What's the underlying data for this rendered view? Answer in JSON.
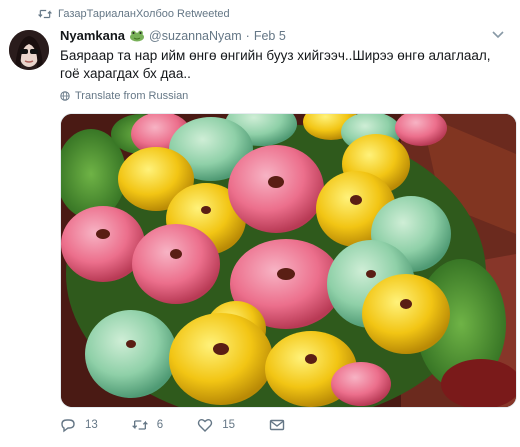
{
  "retweet": {
    "icon": "retweet-icon",
    "text": "ГазарТариаланХолбоо Retweeted"
  },
  "tweet": {
    "display_name": "Nyamkana",
    "name_emoji": "frog-icon",
    "handle": "@suzannaNyam",
    "separator": "·",
    "time": "Feb 5",
    "text": "Баяраар та нар ийм өнгө өнгийн бууз хийгээч..Ширээ өнгө алаглаал, гоё харагдах бх даа..",
    "translate_label": "Translate from Russian"
  },
  "actions": {
    "reply_count": "13",
    "retweet_count": "6",
    "like_count": "15",
    "icons": [
      "reply-icon",
      "retweet-icon",
      "heart-icon",
      "message-icon"
    ]
  },
  "colors": {
    "accent": "#1da1f2",
    "muted": "#657786",
    "text": "#14171a"
  }
}
